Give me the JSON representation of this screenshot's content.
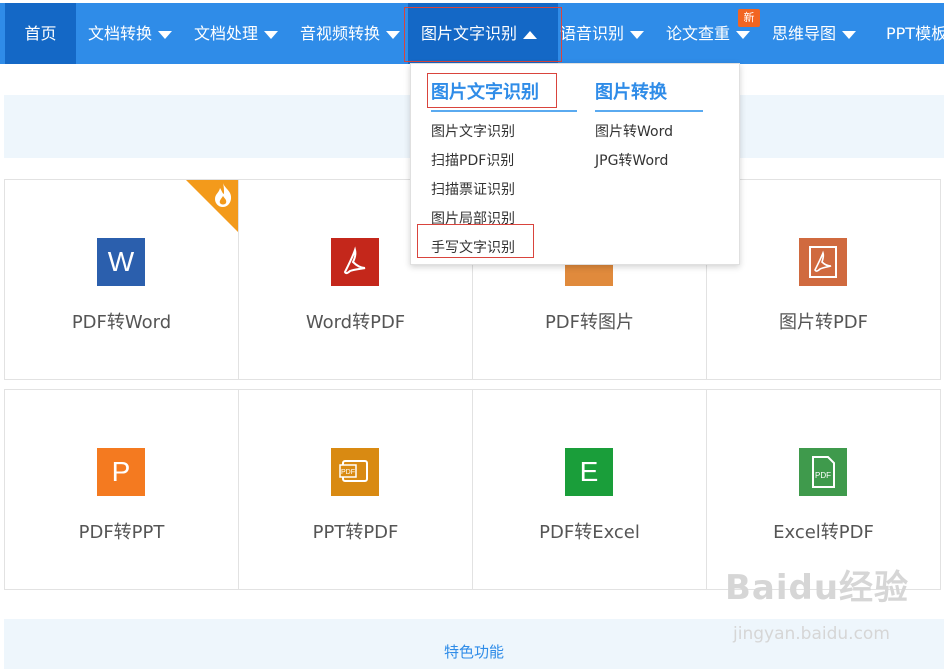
{
  "nav": {
    "home": "首页",
    "items": [
      {
        "label": "文档转换"
      },
      {
        "label": "文档处理"
      },
      {
        "label": "音视频转换"
      },
      {
        "label": "图片文字识别"
      },
      {
        "label": "语音识别"
      },
      {
        "label": "论文查重"
      },
      {
        "label": "思维导图"
      },
      {
        "label": "PPT模板"
      }
    ],
    "active_index": 3,
    "badge": "新"
  },
  "dropdown": {
    "col1": {
      "title": "图片文字识别",
      "items": [
        "图片文字识别",
        "扫描PDF识别",
        "扫描票证识别",
        "图片局部识别",
        "手写文字识别"
      ]
    },
    "col2": {
      "title": "图片转换",
      "items": [
        "图片转Word",
        "JPG转Word"
      ]
    }
  },
  "tiles_row1": [
    {
      "label": "PDF转Word",
      "icon": "word-icon",
      "glyph": "W",
      "color": "#2b5fad",
      "hot": true
    },
    {
      "label": "Word转PDF",
      "icon": "pdf-icon",
      "glyph": "",
      "color": "#c4271b"
    },
    {
      "label": "PDF转图片",
      "icon": "image-icon",
      "glyph": "",
      "color": "#e08a3c"
    },
    {
      "label": "图片转PDF",
      "icon": "pdf-icon",
      "glyph": "",
      "color": "#d06a3f"
    }
  ],
  "tiles_row2": [
    {
      "label": "PDF转PPT",
      "icon": "ppt-icon",
      "glyph": "P",
      "color": "#f47a20"
    },
    {
      "label": "PPT转PDF",
      "icon": "ppt-pdf-icon",
      "glyph": "PDF",
      "color": "#d98a12"
    },
    {
      "label": "PDF转Excel",
      "icon": "excel-icon",
      "glyph": "E",
      "color": "#1a9e3a"
    },
    {
      "label": "Excel转PDF",
      "icon": "excel-pdf-icon",
      "glyph": "PDF",
      "color": "#3f9a4c"
    }
  ],
  "feature": {
    "label": "特色功能"
  },
  "watermark": {
    "logo": "Baidu经验",
    "url": "jingyan.baidu.com"
  }
}
